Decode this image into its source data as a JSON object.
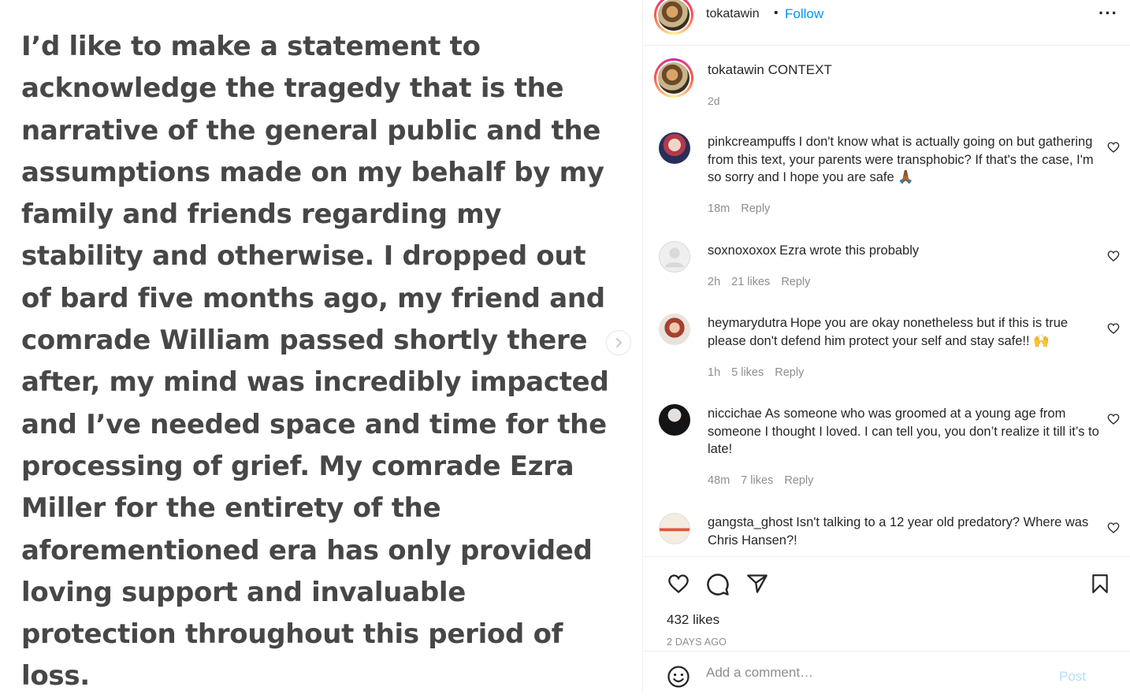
{
  "post": {
    "image_text": "I’d like to make a statement to acknowledge the tragedy that is the narrative of the general public and the assumptions made on my behalf by my family and friends regarding my stability and otherwise. I dropped out of bard five months ago, my friend and comrade William passed shortly there after, my mind was incredibly impacted and I’ve needed space and time for the processing of grief. My comrade Ezra Miller for the entirety of the aforementioned era has only provided loving support and invaluable protection throughout this period of loss."
  },
  "header": {
    "username": "tokatawin",
    "separator": "•",
    "follow_label": "Follow",
    "more_label": "···"
  },
  "caption": {
    "username": "tokatawin",
    "text": "CONTEXT",
    "time": "2d"
  },
  "comments": [
    {
      "username": "pinkcreampuffs",
      "text": "I don't know what is actually going on but gathering from this text, your parents were transphobic? If that's the case, I'm so sorry and I hope you are safe 🙏🏾",
      "time": "18m",
      "likes": "",
      "reply": "Reply"
    },
    {
      "username": "soxnoxoxox",
      "text": "Ezra wrote this probably",
      "time": "2h",
      "likes": "21 likes",
      "reply": "Reply"
    },
    {
      "username": "heymarydutra",
      "text": "Hope you are okay nonetheless but if this is true please don't defend him protect your self and stay safe!! 🙌",
      "time": "1h",
      "likes": "5 likes",
      "reply": "Reply"
    },
    {
      "username": "niccichae",
      "text": "As someone who was groomed at a young age from someone I thought I loved. I can tell you, you don’t realize it till it’s to late!",
      "time": "48m",
      "likes": "7 likes",
      "reply": "Reply"
    },
    {
      "username": "gangsta_ghost",
      "text": "Isn't talking to a 12 year old predatory? Where was Chris Hansen?!",
      "time": "",
      "likes": "",
      "reply": ""
    }
  ],
  "footer": {
    "likes": "432 likes",
    "date": "2 DAYS AGO",
    "comment_placeholder": "Add a comment…",
    "post_label": "Post"
  },
  "colors": {
    "link_blue": "#0095f6",
    "muted": "#8e8e8e",
    "post_disabled": "#b2dffc",
    "text": "#262626"
  }
}
